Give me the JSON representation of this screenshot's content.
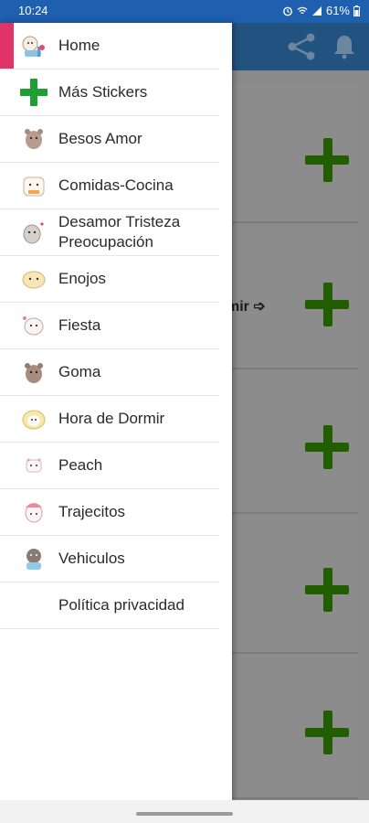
{
  "status_bar": {
    "time": "10:24",
    "battery": "61%"
  },
  "drawer": {
    "items": [
      {
        "label": "Home",
        "icon": "home-sticker-icon",
        "selected": true
      },
      {
        "label": "Más Stickers",
        "icon": "plus-icon"
      },
      {
        "label": "Besos Amor",
        "icon": "kiss-sticker-icon"
      },
      {
        "label": "Comidas-Cocina",
        "icon": "food-sticker-icon"
      },
      {
        "label": "Desamor Tristeza Preocupación",
        "icon": "sad-sticker-icon"
      },
      {
        "label": "Enojos",
        "icon": "angry-sticker-icon"
      },
      {
        "label": "Fiesta",
        "icon": "party-sticker-icon"
      },
      {
        "label": "Goma",
        "icon": "goma-sticker-icon"
      },
      {
        "label": "Hora de Dormir",
        "icon": "sleep-sticker-icon"
      },
      {
        "label": "Peach",
        "icon": "peach-sticker-icon"
      },
      {
        "label": "Trajecitos",
        "icon": "outfit-sticker-icon"
      },
      {
        "label": "Vehiculos",
        "icon": "vehicle-sticker-icon"
      },
      {
        "label": "Política privacidad",
        "icon": ""
      }
    ]
  },
  "background": {
    "peek_text": "mir ➩",
    "accent_color": "#225d00",
    "toolbar_color": "#22527f",
    "highlight_color": "#e0336a"
  }
}
